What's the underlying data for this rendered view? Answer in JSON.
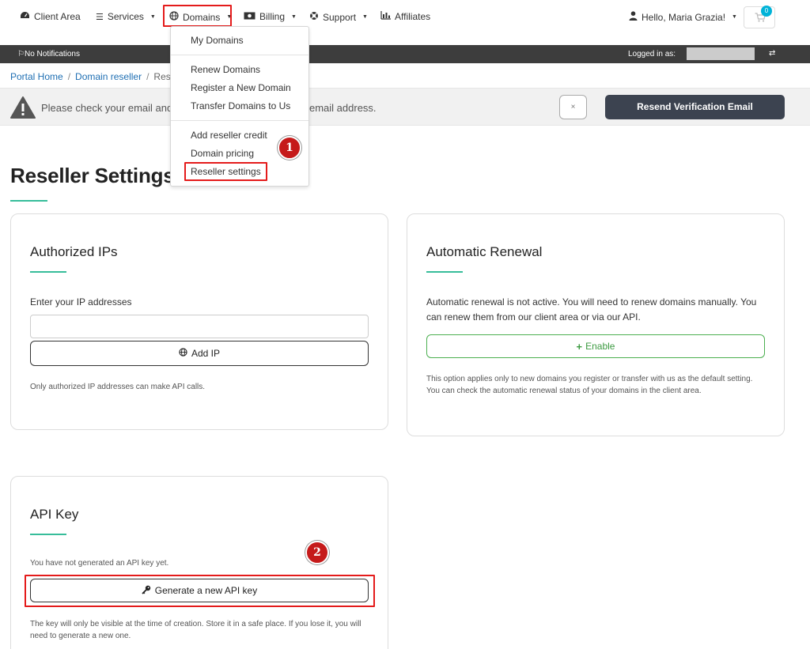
{
  "nav": {
    "client_area": "Client Area",
    "services": "Services",
    "domains": "Domains",
    "billing": "Billing",
    "support": "Support",
    "affiliates": "Affiliates",
    "user_greeting": "Hello, Maria Grazia!",
    "cart_count": "0"
  },
  "notif_bar": {
    "notifications": "No Notifications",
    "logged_in_as": "Logged in as:"
  },
  "breadcrumb": {
    "home": "Portal Home",
    "section": "Domain reseller",
    "current": "Rese"
  },
  "alert": {
    "text_start": "Please check your email and",
    "text_end": "email address.",
    "close_label": "×",
    "resend_label": "Resend Verification Email"
  },
  "domains_menu": {
    "items": [
      "My Domains",
      "Renew Domains",
      "Register a New Domain",
      "Transfer Domains to Us",
      "Add reseller credit",
      "Domain pricing",
      "Reseller settings"
    ]
  },
  "steps": [
    "1",
    "2"
  ],
  "page": {
    "title": "Reseller Settings"
  },
  "authorized_ips": {
    "title": "Authorized IPs",
    "label": "Enter your IP addresses",
    "input_value": "",
    "add_button": "Add IP",
    "note": "Only authorized IP addresses can make API calls."
  },
  "auto_renewal": {
    "title": "Automatic Renewal",
    "description": "Automatic renewal is not active. You will need to renew domains manually. You can renew them from our client area or via our API.",
    "enable_button": "Enable",
    "note": "This option applies only to new domains you register or transfer with us as the default setting. You can check the automatic renewal status of your domains in the client area."
  },
  "api_key": {
    "title": "API Key",
    "status": "You have not generated an API key yet.",
    "generate_button": "Generate a new API key",
    "note": "The key will only be visible at the time of creation. Store it in a safe place. If you lose it, you will need to generate a new one."
  },
  "colors": {
    "highlight": "#e41b1b",
    "accent": "#37bd9a",
    "dark_bar": "#3d3d3d",
    "enable_green": "#4caf50",
    "step_red": "#c51a1a"
  }
}
